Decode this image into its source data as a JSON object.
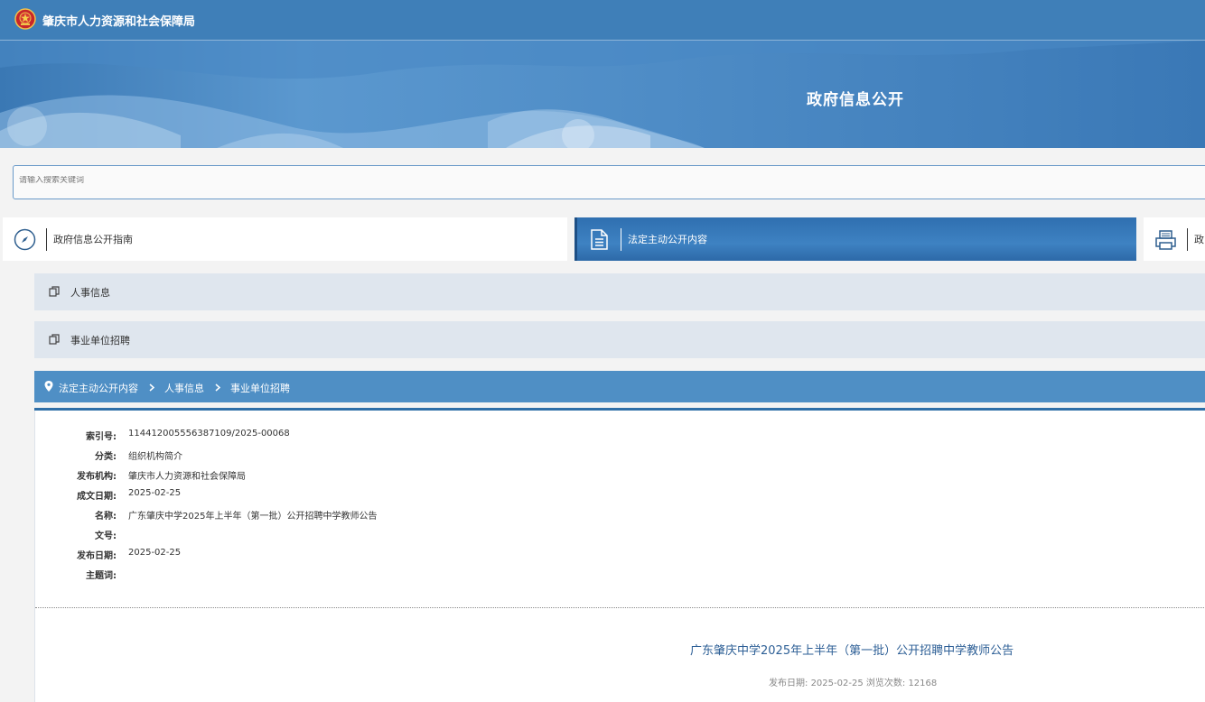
{
  "header": {
    "site_name": "肇庆市人力资源和社会保障局",
    "banner_title": "政府信息公开"
  },
  "search": {
    "placeholder": "请输入搜索关键词"
  },
  "tabs": [
    {
      "label": "政府信息公开指南",
      "icon": "compass-icon"
    },
    {
      "label": "法定主动公开内容",
      "icon": "document-icon",
      "active": true
    },
    {
      "label": "政",
      "icon": "printer-icon"
    }
  ],
  "subnav": [
    {
      "label": "人事信息",
      "icon": "copy-icon"
    },
    {
      "label": "事业单位招聘",
      "icon": "copy-icon"
    }
  ],
  "breadcrumb": [
    "法定主动公开内容",
    "人事信息",
    "事业单位招聘"
  ],
  "meta": [
    {
      "label": "索引号:",
      "value": "11441200555638710​9/2025-00068"
    },
    {
      "label": "分类:",
      "value": "组织机构简介"
    },
    {
      "label": "发布机构:",
      "value": "肇庆市人力资源和社会保障局"
    },
    {
      "label": "成文日期:",
      "value": "2025-02-25"
    },
    {
      "label": "名称:",
      "value": "广东肇庆中学2025年上半年（第一批）公开招聘中学教师公告"
    },
    {
      "label": "文号:",
      "value": ""
    },
    {
      "label": "发布日期:",
      "value": "2025-02-25"
    },
    {
      "label": "主题词:",
      "value": ""
    }
  ],
  "article": {
    "title": "广东肇庆中学2025年上半年（第一批）公开招聘中学教师公告",
    "date_label": "发布日期:",
    "date": "2025-02-25",
    "views_label": "浏览次数:",
    "views": "12168"
  },
  "colors": {
    "primary": "#3f7fb8",
    "breadcrumb": "#4f8fc5",
    "active_tab": "#2f6fb0",
    "subnav_bg": "#dfe6ee",
    "title_link": "#2d5f96"
  }
}
